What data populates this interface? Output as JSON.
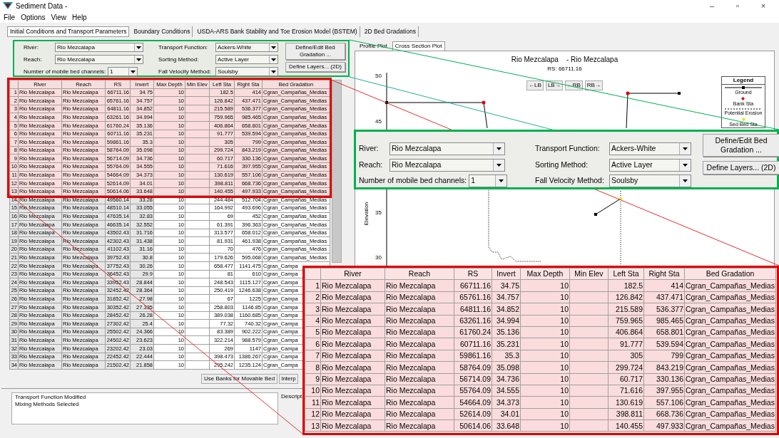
{
  "window": {
    "title": "Sediment Data -",
    "controls": [
      "–",
      "▫",
      "×"
    ]
  },
  "menu": [
    "File",
    "Options",
    "View",
    "Help"
  ],
  "tabs": [
    {
      "label": "Initial Conditions and Transport Parameters",
      "selected": true
    },
    {
      "label": "Boundary Conditions",
      "selected": false
    },
    {
      "label": "USDA-ARS Bank Stability and Toe Erosion Model (BSTEM)",
      "selected": false
    },
    {
      "label": "2D Bed Gradations",
      "selected": false
    }
  ],
  "settings": {
    "river_label": "River:",
    "river": "Rio Mezcalapa",
    "reach_label": "Reach:",
    "reach": "Rio Mezcalapa",
    "channels_label": "Number of mobile bed channels:",
    "channels": "1",
    "transport_label": "Transport Function:",
    "transport": "Ackers-White",
    "sorting_label": "Sorting Method:",
    "sorting": "Active Layer",
    "fall_label": "Fall Velocity Method:",
    "fall": "Soulsby",
    "buttons": [
      "Define/Edit Bed Gradation ...",
      "Define Layers... (2D)"
    ]
  },
  "table": {
    "columns": [
      "River",
      "Reach",
      "RS",
      "Invert",
      "Max Depth",
      "Min Elev",
      "Left Sta",
      "Right Sta",
      "Bed Gradation"
    ],
    "rows": [
      {
        "n": "1",
        "river": "Rio Mezcalapa",
        "reach": "Rio Mezcalapa",
        "rs": "66711.16",
        "invert": "34.75",
        "max_depth": "10",
        "left_sta": "182.5",
        "right_sta": "414",
        "bed": "Cgran_Campañas_Medias",
        "highlighted": true
      },
      {
        "n": "2",
        "river": "Rio Mezcalapa",
        "reach": "Rio Mezcalapa",
        "rs": "65761.16",
        "invert": "34.757",
        "max_depth": "10",
        "left_sta": "126.842",
        "right_sta": "437.471",
        "bed": "Cgran_Campañas_Medias",
        "highlighted": true
      },
      {
        "n": "3",
        "river": "Rio Mezcalapa",
        "reach": "Rio Mezcalapa",
        "rs": "64811.16",
        "invert": "34.852",
        "max_depth": "10",
        "left_sta": "215.589",
        "right_sta": "536.377",
        "bed": "Cgran_Campañas_Medias",
        "highlighted": true
      },
      {
        "n": "4",
        "river": "Rio Mezcalapa",
        "reach": "Rio Mezcalapa",
        "rs": "63261.16",
        "invert": "34.994",
        "max_depth": "10",
        "left_sta": "759.965",
        "right_sta": "985.465",
        "bed": "Cgran_Campañas_Medias",
        "highlighted": true
      },
      {
        "n": "5",
        "river": "Rio Mezcalapa",
        "reach": "Rio Mezcalapa",
        "rs": "61760.24",
        "invert": "35.136",
        "max_depth": "10",
        "left_sta": "406.864",
        "right_sta": "658.801",
        "bed": "Cgran_Campañas_Medias",
        "highlighted": true
      },
      {
        "n": "6",
        "river": "Rio Mezcalapa",
        "reach": "Rio Mezcalapa",
        "rs": "60711.16",
        "invert": "35.231",
        "max_depth": "10",
        "left_sta": "91.777",
        "right_sta": "539.594",
        "bed": "Cgran_Campañas_Medias",
        "highlighted": true
      },
      {
        "n": "7",
        "river": "Rio Mezcalapa",
        "reach": "Rio Mezcalapa",
        "rs": "59861.16",
        "invert": "35.3",
        "max_depth": "10",
        "left_sta": "305",
        "right_sta": "799",
        "bed": "Cgran_Campañas_Medias",
        "highlighted": true
      },
      {
        "n": "8",
        "river": "Rio Mezcalapa",
        "reach": "Rio Mezcalapa",
        "rs": "58764.09",
        "invert": "35.098",
        "max_depth": "10",
        "left_sta": "299.724",
        "right_sta": "843.219",
        "bed": "Cgran_Campañas_Medias",
        "highlighted": true
      },
      {
        "n": "9",
        "river": "Rio Mezcalapa",
        "reach": "Rio Mezcalapa",
        "rs": "56714.09",
        "invert": "34.736",
        "max_depth": "10",
        "left_sta": "60.717",
        "right_sta": "330.136",
        "bed": "Cgran_Campañas_Medias",
        "highlighted": true
      },
      {
        "n": "10",
        "river": "Rio Mezcalapa",
        "reach": "Rio Mezcalapa",
        "rs": "55764.09",
        "invert": "34.555",
        "max_depth": "10",
        "left_sta": "71.616",
        "right_sta": "397.955",
        "bed": "Cgran_Campañas_Medias",
        "highlighted": true
      },
      {
        "n": "11",
        "river": "Rio Mezcalapa",
        "reach": "Rio Mezcalapa",
        "rs": "54664.09",
        "invert": "34.373",
        "max_depth": "10",
        "left_sta": "130.619",
        "right_sta": "557.106",
        "bed": "Cgran_Campañas_Medias",
        "highlighted": true
      },
      {
        "n": "12",
        "river": "Rio Mezcalapa",
        "reach": "Rio Mezcalapa",
        "rs": "52614.09",
        "invert": "34.01",
        "max_depth": "10",
        "left_sta": "398.811",
        "right_sta": "668.736",
        "bed": "Cgran_Campañas_Medias",
        "highlighted": true
      },
      {
        "n": "13",
        "river": "Rio Mezcalapa",
        "reach": "Rio Mezcalapa",
        "rs": "50614.06",
        "invert": "33.648",
        "max_depth": "10",
        "left_sta": "140.455",
        "right_sta": "497.933",
        "bed": "Cgran_Campañas_Medias",
        "highlighted": true
      },
      {
        "n": "14",
        "river": "Rio Mezcalapa",
        "reach": "Rio Mezcalapa",
        "rs": "49560.14",
        "invert": "33.28",
        "max_depth": "10",
        "left_sta": "244.484",
        "right_sta": "512.704",
        "bed": "Cgran_Campañas_Medias",
        "highlighted": false
      },
      {
        "n": "15",
        "river": "Rio Mezcalapa",
        "reach": "Rio Mezcalapa",
        "rs": "48510.14",
        "invert": "33.055",
        "max_depth": "10",
        "left_sta": "164.992",
        "right_sta": "493.696",
        "bed": "Cgran_Campañas_Medias",
        "highlighted": false
      },
      {
        "n": "16",
        "river": "Rio Mezcalapa",
        "reach": "Rio Mezcalapa",
        "rs": "47635.14",
        "invert": "32.83",
        "max_depth": "10",
        "left_sta": "69",
        "right_sta": "452",
        "bed": "Cgran_Campañas_Medias",
        "highlighted": false
      },
      {
        "n": "17",
        "river": "Rio Mezcalapa",
        "reach": "Rio Mezcalapa",
        "rs": "46635.14",
        "invert": "32.552",
        "max_depth": "10",
        "left_sta": "61.391",
        "right_sta": "396.363",
        "bed": "Cgran_Campañas_Medias",
        "highlighted": false
      },
      {
        "n": "18",
        "river": "Rio Mezcalapa",
        "reach": "Rio Mezcalapa",
        "rs": "43502.43",
        "invert": "31.716",
        "max_depth": "10",
        "left_sta": "313.577",
        "right_sta": "658.012",
        "bed": "Cgran_Campañas_Medias",
        "highlighted": false
      },
      {
        "n": "19",
        "river": "Rio Mezcalapa",
        "reach": "Rio Mezcalapa",
        "rs": "42302.43",
        "invert": "31.438",
        "max_depth": "10",
        "left_sta": "81.931",
        "right_sta": "461.938",
        "bed": "Cgran_Campañas_Medias",
        "highlighted": false
      },
      {
        "n": "20",
        "river": "Rio Mezcalapa",
        "reach": "Rio Mezcalapa",
        "rs": "41102.43",
        "invert": "31.16",
        "max_depth": "10",
        "left_sta": "70",
        "right_sta": "476",
        "bed": "Cgran_Campañas_Medias",
        "highlighted": false
      },
      {
        "n": "21",
        "river": "Rio Mezcalapa",
        "reach": "Rio Mezcalapa",
        "rs": "39752.43",
        "invert": "30.8",
        "max_depth": "10",
        "left_sta": "179.626",
        "right_sta": "595.068",
        "bed": "Cgran_Campañas_Medias",
        "highlighted": false
      },
      {
        "n": "22",
        "river": "Rio Mezcalapa",
        "reach": "Rio Mezcalapa",
        "rs": "37752.43",
        "invert": "30.26",
        "max_depth": "10",
        "left_sta": "658.477",
        "right_sta": "1141.475",
        "bed": "Cgran_Campa",
        "highlighted": false
      },
      {
        "n": "23",
        "river": "Rio Mezcalapa",
        "reach": "Rio Mezcalapa",
        "rs": "36452.43",
        "invert": "29.9",
        "max_depth": "10",
        "left_sta": "81",
        "right_sta": "610",
        "bed": "Cgran_Campa",
        "highlighted": false
      },
      {
        "n": "24",
        "river": "Rio Mezcalapa",
        "reach": "Rio Mezcalapa",
        "rs": "33952.43",
        "invert": "28.844",
        "max_depth": "10",
        "left_sta": "248.543",
        "right_sta": "1115.127",
        "bed": "Cgran_Campa",
        "highlighted": false
      },
      {
        "n": "25",
        "river": "Rio Mezcalapa",
        "reach": "Rio Mezcalapa",
        "rs": "32452.42",
        "invert": "28.364",
        "max_depth": "10",
        "left_sta": "250.419",
        "right_sta": "1246.638",
        "bed": "Cgran_Campa",
        "highlighted": false
      },
      {
        "n": "26",
        "river": "Rio Mezcalapa",
        "reach": "Rio Mezcalapa",
        "rs": "31852.42",
        "invert": "27.98",
        "max_depth": "10",
        "left_sta": "67",
        "right_sta": "1225",
        "bed": "Cgran_Campa",
        "highlighted": false
      },
      {
        "n": "27",
        "river": "Rio Mezcalapa",
        "reach": "Rio Mezcalapa",
        "rs": "30352.42",
        "invert": "27.335",
        "max_depth": "10",
        "left_sta": "258.803",
        "right_sta": "1146.85",
        "bed": "Cgran_Campa",
        "highlighted": false
      },
      {
        "n": "28",
        "river": "Rio Mezcalapa",
        "reach": "Rio Mezcalapa",
        "rs": "28452.42",
        "invert": "26.28",
        "max_depth": "10",
        "left_sta": "389.038",
        "right_sta": "1160.685",
        "bed": "Cgran_Campa",
        "highlighted": false
      },
      {
        "n": "29",
        "river": "Rio Mezcalapa",
        "reach": "Rio Mezcalapa",
        "rs": "27302.42",
        "invert": "25.4",
        "max_depth": "10",
        "left_sta": "77.32",
        "right_sta": "740.32",
        "bed": "Cgran_Campa",
        "highlighted": false
      },
      {
        "n": "30",
        "river": "Rio Mezcalapa",
        "reach": "Rio Mezcalapa",
        "rs": "25502.42",
        "invert": "24.366",
        "max_depth": "10",
        "left_sta": "83.389",
        "right_sta": "902.222",
        "bed": "Cgran_Campa",
        "highlighted": false
      },
      {
        "n": "31",
        "river": "Rio Mezcalapa",
        "reach": "Rio Mezcalapa",
        "rs": "24502.42",
        "invert": "23.623",
        "max_depth": "10",
        "left_sta": "322.214",
        "right_sta": "988.579",
        "bed": "Cgran_Campa",
        "highlighted": false
      },
      {
        "n": "32",
        "river": "Rio Mezcalapa",
        "reach": "Rio Mezcalapa",
        "rs": "23202.42",
        "invert": "23.03",
        "max_depth": "10",
        "left_sta": "269",
        "right_sta": "1147",
        "bed": "Cgran_Campa",
        "highlighted": false
      },
      {
        "n": "33",
        "river": "Rio Mezcalapa",
        "reach": "Rio Mezcalapa",
        "rs": "22452.42",
        "invert": "22.444",
        "max_depth": "10",
        "left_sta": "398.473",
        "right_sta": "1386.267",
        "bed": "Cgran_Campa",
        "highlighted": false
      },
      {
        "n": "34",
        "river": "Rio Mezcalapa",
        "reach": "Rio Mezcalapa",
        "rs": "21502.42",
        "invert": "21.858",
        "max_depth": "10",
        "left_sta": "295.242",
        "right_sta": "1235.124",
        "bed": "Cgran_Campa",
        "highlighted": false
      }
    ]
  },
  "table_buttons": [
    "Use Banks for Movable Bed",
    "Interp"
  ],
  "messages": [
    "Transport Function Modified",
    "Mixing Methods Selected"
  ],
  "description_label": "Descript",
  "plot": {
    "tabs": [
      {
        "label": "Profile Plot",
        "selected": false
      },
      {
        "label": "Cross Section Plot",
        "selected": true
      }
    ],
    "title": "Rio Mezcalapa    - Rio Mezcalapa",
    "subtitle": "RS: 66711.16",
    "bank_buttons": [
      "←LB",
      "LB→",
      "←RB",
      "RB→"
    ],
    "yticks": [
      "50",
      "45",
      "35",
      "30"
    ],
    "ylabel": "Elevation",
    "legend": {
      "title": "Legend",
      "items": [
        {
          "label": "Ground",
          "kind": "line"
        },
        {
          "label": "Bank Sta",
          "kind": "bank"
        },
        {
          "label": "Potential Erosion",
          "kind": "dotted"
        },
        {
          "label": "Sed Bed Sta",
          "kind": "sed"
        }
      ]
    }
  },
  "settings_callout": {
    "river_label": "River:",
    "river": "Rio Mezcalapa",
    "reach_label": "Reach:",
    "reach": "Rio Mezcalapa",
    "channels_label": "Number of mobile bed channels:",
    "channels": "1",
    "transport_label": "Transport Function:",
    "transport": "Ackers-White",
    "sorting_label": "Sorting Method:",
    "sorting": "Active Layer",
    "fall_label": "Fall Velocity Method:",
    "fall": "Soulsby",
    "buttons": [
      "Define/Edit Bed Gradation ...",
      "Define Layers... (2D)"
    ]
  },
  "table_callout": {
    "columns": [
      "River",
      "Reach",
      "RS",
      "Invert",
      "Max Depth",
      "Min Elev",
      "Left Sta",
      "Right Sta",
      "Bed Gradation"
    ],
    "rows": [
      {
        "n": "1",
        "river": "Rio Mezcalapa",
        "reach": "Rio Mezcalapa",
        "rs": "66711.16",
        "invert": "34.75",
        "max_depth": "10",
        "left_sta": "182.5",
        "right_sta": "414",
        "bed": "Cgran_Campañas_Medias"
      },
      {
        "n": "2",
        "river": "Rio Mezcalapa",
        "reach": "Rio Mezcalapa",
        "rs": "65761.16",
        "invert": "34.757",
        "max_depth": "10",
        "left_sta": "126.842",
        "right_sta": "437.471",
        "bed": "Cgran_Campañas_Medias"
      },
      {
        "n": "3",
        "river": "Rio Mezcalapa",
        "reach": "Rio Mezcalapa",
        "rs": "64811.16",
        "invert": "34.852",
        "max_depth": "10",
        "left_sta": "215.589",
        "right_sta": "536.377",
        "bed": "Cgran_Campañas_Medias"
      },
      {
        "n": "4",
        "river": "Rio Mezcalapa",
        "reach": "Rio Mezcalapa",
        "rs": "63261.16",
        "invert": "34.994",
        "max_depth": "10",
        "left_sta": "759.965",
        "right_sta": "985.465",
        "bed": "Cgran_Campañas_Medias"
      },
      {
        "n": "5",
        "river": "Rio Mezcalapa",
        "reach": "Rio Mezcalapa",
        "rs": "61760.24",
        "invert": "35.136",
        "max_depth": "10",
        "left_sta": "406.864",
        "right_sta": "658.801",
        "bed": "Cgran_Campañas_Medias"
      },
      {
        "n": "6",
        "river": "Rio Mezcalapa",
        "reach": "Rio Mezcalapa",
        "rs": "60711.16",
        "invert": "35.231",
        "max_depth": "10",
        "left_sta": "91.777",
        "right_sta": "539.594",
        "bed": "Cgran_Campañas_Medias"
      },
      {
        "n": "7",
        "river": "Rio Mezcalapa",
        "reach": "Rio Mezcalapa",
        "rs": "59861.16",
        "invert": "35.3",
        "max_depth": "10",
        "left_sta": "305",
        "right_sta": "799",
        "bed": "Cgran_Campañas_Medias"
      },
      {
        "n": "8",
        "river": "Rio Mezcalapa",
        "reach": "Rio Mezcalapa",
        "rs": "58764.09",
        "invert": "35.098",
        "max_depth": "10",
        "left_sta": "299.724",
        "right_sta": "843.219",
        "bed": "Cgran_Campañas_Medias"
      },
      {
        "n": "9",
        "river": "Rio Mezcalapa",
        "reach": "Rio Mezcalapa",
        "rs": "56714.09",
        "invert": "34.736",
        "max_depth": "10",
        "left_sta": "60.717",
        "right_sta": "330.136",
        "bed": "Cgran_Campañas_Medias"
      },
      {
        "n": "10",
        "river": "Rio Mezcalapa",
        "reach": "Rio Mezcalapa",
        "rs": "55764.09",
        "invert": "34.555",
        "max_depth": "10",
        "left_sta": "71.616",
        "right_sta": "397.955",
        "bed": "Cgran_Campañas_Medias"
      },
      {
        "n": "11",
        "river": "Rio Mezcalapa",
        "reach": "Rio Mezcalapa",
        "rs": "54664.09",
        "invert": "34.373",
        "max_depth": "10",
        "left_sta": "130.619",
        "right_sta": "557.106",
        "bed": "Cgran_Campañas_Medias"
      },
      {
        "n": "12",
        "river": "Rio Mezcalapa",
        "reach": "Rio Mezcalapa",
        "rs": "52614.09",
        "invert": "34.01",
        "max_depth": "10",
        "left_sta": "398.811",
        "right_sta": "668.736",
        "bed": "Cgran_Campañas_Medias"
      },
      {
        "n": "13",
        "river": "Rio Mezcalapa",
        "reach": "Rio Mezcalapa",
        "rs": "50614.06",
        "invert": "33.648",
        "max_depth": "10",
        "left_sta": "140.455",
        "right_sta": "497.933",
        "bed": "Cgran_Campañas_Medias"
      }
    ]
  }
}
